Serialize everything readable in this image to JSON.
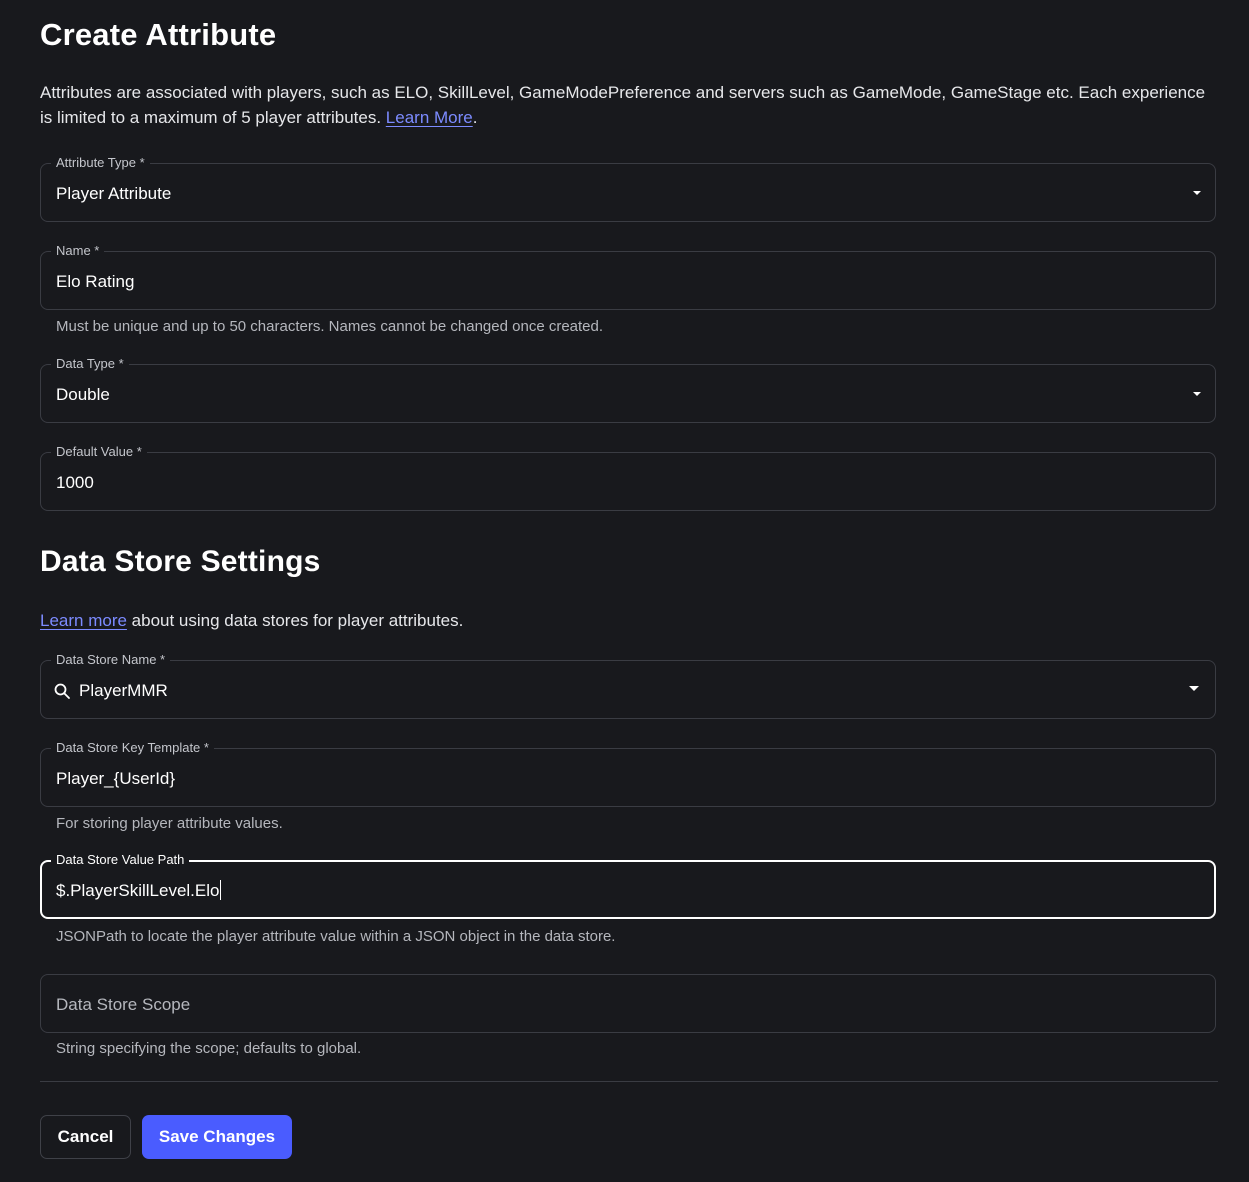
{
  "page": {
    "title": "Create Attribute",
    "description_prefix": "Attributes are associated with players, such as ELO, SkillLevel, GameModePreference and servers such as GameMode, GameStage etc. Each experience is limited to a maximum of 5 player attributes. ",
    "description_link": "Learn More",
    "description_suffix": "."
  },
  "fields": {
    "attribute_type": {
      "label": "Attribute Type *",
      "value": "Player Attribute",
      "icon": "chevron-down-icon"
    },
    "name": {
      "label": "Name *",
      "value": "Elo Rating",
      "helper": "Must be unique and up to 50 characters. Names cannot be changed once created."
    },
    "data_type": {
      "label": "Data Type *",
      "value": "Double",
      "icon": "chevron-down-icon"
    },
    "default_value": {
      "label": "Default Value *",
      "value": "1000"
    }
  },
  "data_store": {
    "title": "Data Store Settings",
    "desc_link": "Learn more",
    "desc_suffix": " about using data stores for player attributes.",
    "name": {
      "label": "Data Store Name *",
      "value": "PlayerMMR",
      "icons": [
        "search-icon",
        "chevron-down-icon"
      ]
    },
    "key_template": {
      "label": "Data Store Key Template *",
      "value": "Player_{UserId}",
      "helper": "For storing player attribute values."
    },
    "value_path": {
      "label": "Data Store Value Path",
      "value": "$.PlayerSkillLevel.Elo",
      "helper": "JSONPath to locate the player attribute value within a JSON object in the data store."
    },
    "scope": {
      "placeholder": "Data Store Scope",
      "helper": "String specifying the scope; defaults to global."
    }
  },
  "actions": {
    "cancel": "Cancel",
    "save": "Save Changes"
  },
  "colors": {
    "background": "#18191d",
    "link": "#7c8bff",
    "primary_button": "#4a5cff",
    "border": "#3a3c43"
  }
}
